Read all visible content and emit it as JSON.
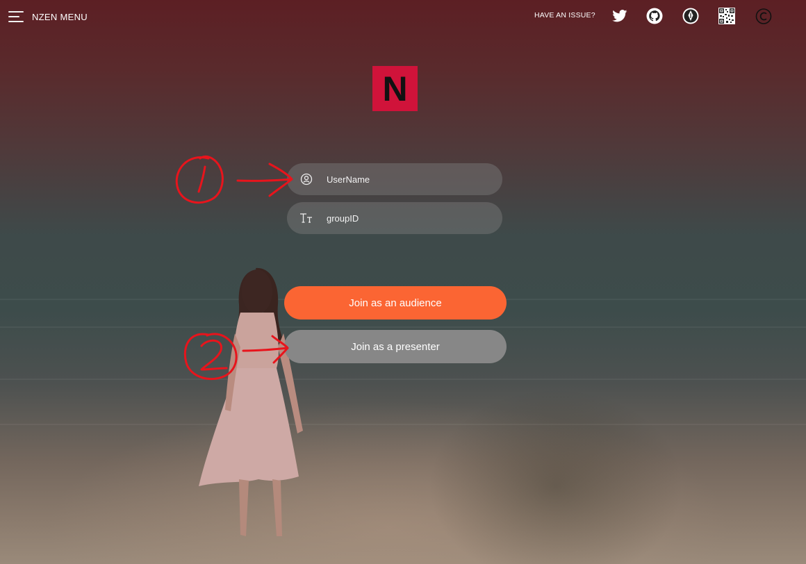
{
  "topbar": {
    "menu_label": "NZEN MENU",
    "issue_label": "HAVE AN ISSUE?",
    "icons": [
      "twitter-icon",
      "github-icon",
      "pen-nib-icon",
      "qr-code-icon",
      "copyright-icon"
    ]
  },
  "logo": {
    "letter": "N",
    "color": "#d0133a"
  },
  "form": {
    "username_placeholder": "UserName",
    "groupid_placeholder": "groupID"
  },
  "buttons": {
    "audience": "Join as an audience",
    "presenter": "Join as a presenter"
  },
  "colors": {
    "accent": "#fb6533",
    "secondary_button": "#878787",
    "annotation": "#e8141c"
  }
}
